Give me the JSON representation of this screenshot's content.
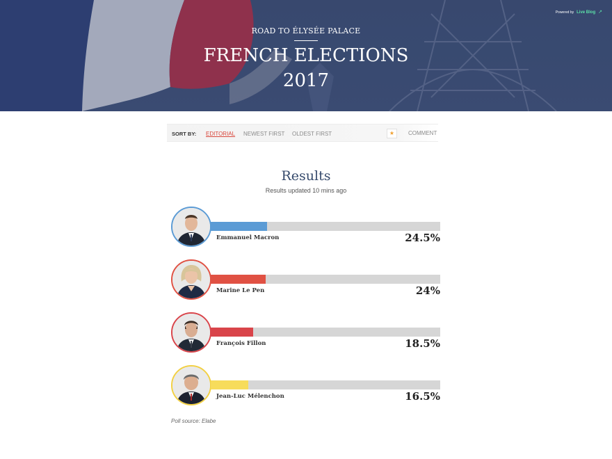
{
  "hero": {
    "powered_by": "Powered by",
    "brand": "Live Blog",
    "kicker": "ROAD TO ÉLYSÉE PALACE",
    "title_line1": "FRENCH ELECTIONS",
    "title_line2": "2017"
  },
  "sortbar": {
    "label": "SORT BY:",
    "options": [
      "EDITORIAL",
      "NEWEST FIRST",
      "OLDEST FIRST"
    ],
    "selected": "EDITORIAL",
    "star_icon": "★",
    "comment_label": "COMMENT"
  },
  "results": {
    "title": "Results",
    "updated": "Results updated 10 mins ago",
    "candidates": [
      {
        "name": "Emmanuel Macron",
        "percent_label": "24.5%",
        "share": 24.5,
        "color": "#5b9bd5"
      },
      {
        "name": "Marine Le Pen",
        "percent_label": "24%",
        "share": 24,
        "color": "#e05143"
      },
      {
        "name": "François Fillon",
        "percent_label": "18.5%",
        "share": 18.5,
        "color": "#d9444a"
      },
      {
        "name": "Jean-Luc Mélenchon",
        "percent_label": "16.5%",
        "share": 16.5,
        "color": "#f7dc5b"
      }
    ],
    "source": "Poll source: Elabe"
  },
  "colors": {
    "accent_red": "#d9473c",
    "hero_blue": "#3c4d72",
    "results_title": "#364a6c"
  }
}
